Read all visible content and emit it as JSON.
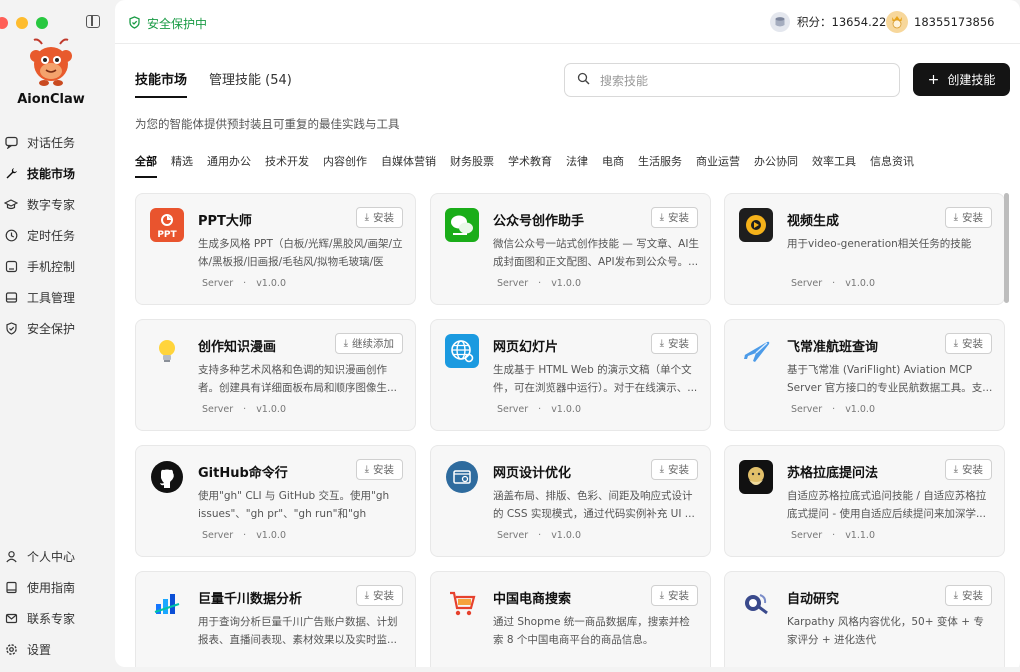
{
  "app": {
    "name": "AionClaw"
  },
  "sidebar": {
    "items": [
      {
        "label": "对话任务",
        "icon": "chat-icon"
      },
      {
        "label": "技能市场",
        "icon": "wrench-icon",
        "active": true
      },
      {
        "label": "数字专家",
        "icon": "graduation-cap-icon"
      },
      {
        "label": "定时任务",
        "icon": "clock-icon"
      },
      {
        "label": "手机控制",
        "icon": "phone-icon"
      },
      {
        "label": "工具管理",
        "icon": "toolbox-icon"
      },
      {
        "label": "安全保护",
        "icon": "shield-icon"
      }
    ],
    "bottom_items": [
      {
        "label": "个人中心",
        "icon": "person-icon"
      },
      {
        "label": "使用指南",
        "icon": "book-icon"
      },
      {
        "label": "联系专家",
        "icon": "mail-icon"
      },
      {
        "label": "设置",
        "icon": "gear-icon"
      }
    ]
  },
  "topbar": {
    "security_status": "安全保护中",
    "points_label": "积分：13654.22",
    "username": "18355173856"
  },
  "tabs": [
    {
      "label": "技能市场",
      "active": true
    },
    {
      "label": "管理技能 (54)",
      "active": false
    }
  ],
  "search": {
    "placeholder": "搜索技能"
  },
  "create_button": {
    "label": "创建技能"
  },
  "subtitle": "为您的智能体提供预封装且可重复的最佳实践与工具",
  "categories": [
    "全部",
    "精选",
    "通用办公",
    "技术开发",
    "内容创作",
    "自媒体营销",
    "财务股票",
    "学术教育",
    "法律",
    "电商",
    "生活服务",
    "商业运营",
    "办公协同",
    "效率工具",
    "信息资讯"
  ],
  "skills": [
    {
      "title": "PPT大师",
      "desc": "生成多风格 PPT（白板/光辉/黑胶风/画架/立体/黑板报/旧画报/毛毡风/拟物毛玻璃/医疗/...",
      "server": "Server",
      "version": "v1.0.0",
      "button": "安装",
      "icon": "ppt-icon",
      "color": "#e9542e"
    },
    {
      "title": "公众号创作助手",
      "desc": "微信公众号一站式创作技能 — 写文章、AI生成封面图和正文配图、API发布到公众号。...",
      "server": "Server",
      "version": "v1.0.0",
      "button": "安装",
      "icon": "wechat-icon",
      "color": "#1aad19"
    },
    {
      "title": "视频生成",
      "desc": "用于video-generation相关任务的技能",
      "server": "Server",
      "version": "v1.0.0",
      "button": "安装",
      "icon": "video-icon",
      "color": "#1e1e1e"
    },
    {
      "title": "创作知识漫画",
      "desc": "支持多种艺术风格和色调的知识漫画创作者。创建具有详细面板布局和顺序图像生...",
      "server": "Server",
      "version": "v1.0.0",
      "button": "继续添加",
      "icon": "lightbulb-icon",
      "color": "#ffffff"
    },
    {
      "title": "网页幻灯片",
      "desc": "生成基于 HTML Web 的演示文稿（单个文件，可在浏览器中运行）。对于在线演示、...",
      "server": "Server",
      "version": "v1.0.0",
      "button": "安装",
      "icon": "globe-icon",
      "color": "#1b9ae0"
    },
    {
      "title": "飞常准航班查询",
      "desc": "基于飞常准 (VariFlight) Aviation MCP Server 官方接口的专业民航数据工具。支...",
      "server": "Server",
      "version": "v1.0.0",
      "button": "安装",
      "icon": "airplane-icon",
      "color": "#ffffff"
    },
    {
      "title": "GitHub命令行",
      "desc": "使用\"gh\" CLI 与 GitHub 交互。使用\"gh issues\"、\"gh pr\"、\"gh run\"和\"gh api\"来...",
      "server": "Server",
      "version": "v1.0.0",
      "button": "安装",
      "icon": "github-icon",
      "color": "#ffffff"
    },
    {
      "title": "网页设计优化",
      "desc": "涵盖布局、排版、色彩、间距及响应式设计的 CSS 实现模式，通过代码实例补充 UI ...",
      "server": "Server",
      "version": "v1.0.0",
      "button": "安装",
      "icon": "web-design-icon",
      "color": "#2e6b9e"
    },
    {
      "title": "苏格拉底提问法",
      "desc": "自适应苏格拉底式追问技能 / 自适应苏格拉底式提问 - 使用自适应后续提问来加深学...",
      "server": "Server",
      "version": "v1.1.0",
      "button": "安装",
      "icon": "socrates-icon",
      "color": "#111111"
    },
    {
      "title": "巨量千川数据分析",
      "desc": "用于查询分析巨量千川广告账户数据、计划报表、直播间表现、素材效果以及实时监...",
      "server": "",
      "version": "",
      "button": "安装",
      "icon": "bar-chart-icon",
      "color": "#ffffff"
    },
    {
      "title": "中国电商搜索",
      "desc": "通过 Shopme 统一商品数据库，搜索并检索 8 个中国电商平台的商品信息。",
      "server": "",
      "version": "",
      "button": "安装",
      "icon": "cart-icon",
      "color": "#ffffff"
    },
    {
      "title": "自动研究",
      "desc": "Karpathy 风格内容优化，50+ 变体 + 专家评分 + 进化迭代",
      "server": "",
      "version": "",
      "button": "安装",
      "icon": "research-icon",
      "color": "#ffffff"
    }
  ]
}
